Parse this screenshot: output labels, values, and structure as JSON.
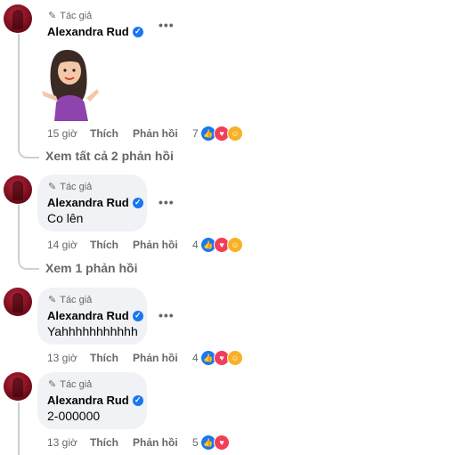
{
  "comments": [
    {
      "author_badge": "Tác giả",
      "author": "Alexandra Rud",
      "text": "",
      "has_sticker": true,
      "time": "15 giờ",
      "like_label": "Thích",
      "reply_label": "Phản hồi",
      "reaction_count": "7",
      "reactions": [
        "like-icon",
        "love-icon",
        "care-icon"
      ]
    },
    {
      "author_badge": "Tác giả",
      "author": "Alexandra Rud",
      "text": "Co lên",
      "time": "14 giờ",
      "like_label": "Thích",
      "reply_label": "Phản hồi",
      "reaction_count": "4",
      "reactions": [
        "like-icon",
        "love-icon",
        "care-icon"
      ]
    },
    {
      "author_badge": "Tác giả",
      "author": "Alexandra Rud",
      "text": "Yahhhhhhhhhhh",
      "time": "13 giờ",
      "like_label": "Thích",
      "reply_label": "Phản hồi",
      "reaction_count": "4",
      "reactions": [
        "like-icon",
        "love-icon",
        "care-icon"
      ]
    },
    {
      "author_badge": "Tác giả",
      "author": "Alexandra Rud",
      "text": "2-000000",
      "time": "13 giờ",
      "like_label": "Thích",
      "reply_label": "Phản hồi",
      "reaction_count": "5",
      "reactions": [
        "like-icon",
        "love-icon"
      ]
    }
  ],
  "view_replies": [
    "Xem tất cả 2 phản hồi",
    "Xem 1 phản hồi"
  ],
  "colors": {
    "verified": "#1877f2",
    "like": "#1877f2",
    "love": "#f33e58",
    "care": "#f7b125",
    "secondary_text": "#65676b",
    "bubble": "#f0f2f5"
  }
}
